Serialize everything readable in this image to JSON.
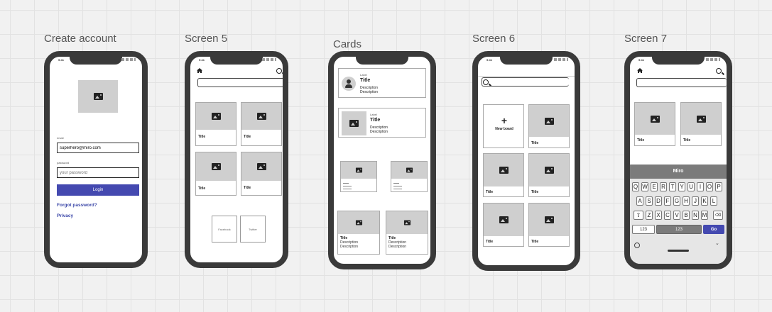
{
  "frames": [
    {
      "label": "Create account"
    },
    {
      "label": "Screen 5"
    },
    {
      "label": "Cards"
    },
    {
      "label": "Screen 6"
    },
    {
      "label": "Screen 7"
    }
  ],
  "status": {
    "time": "9:41"
  },
  "create_account": {
    "email_label": "email",
    "email_value": "superhero@miro.com",
    "password_label": "password",
    "password_placeholder": "your password",
    "login_button": "Login",
    "forgot_password": "Forgot password?",
    "privacy": "Privacy"
  },
  "screen5": {
    "cards": [
      "Title",
      "Title",
      "Title",
      "Title"
    ],
    "small_buttons": [
      "Facebook",
      "Twitter"
    ]
  },
  "cards_screen": {
    "label": "Label",
    "title": "Title",
    "description": "Description",
    "small_label": "Label",
    "bottom_title": "Title"
  },
  "screen6": {
    "new_board": "New board",
    "cards": [
      "Title",
      "Title",
      "Title",
      "Title",
      "Title"
    ]
  },
  "screen7": {
    "cards": [
      "Title",
      "Title"
    ],
    "keyboard_title": "Miro",
    "row1": [
      "Q",
      "W",
      "E",
      "R",
      "T",
      "Y",
      "U",
      "I",
      "O",
      "P"
    ],
    "row2": [
      "A",
      "S",
      "D",
      "F",
      "G",
      "H",
      "J",
      "K",
      "L"
    ],
    "row3": [
      "Z",
      "X",
      "C",
      "V",
      "B",
      "N",
      "M"
    ],
    "num_key": "123",
    "space_key": "123",
    "go_key": "Go"
  },
  "colors": {
    "accent": "#4449b0",
    "placeholder": "#cfcfcf",
    "bezel": "#3a3a3a"
  }
}
